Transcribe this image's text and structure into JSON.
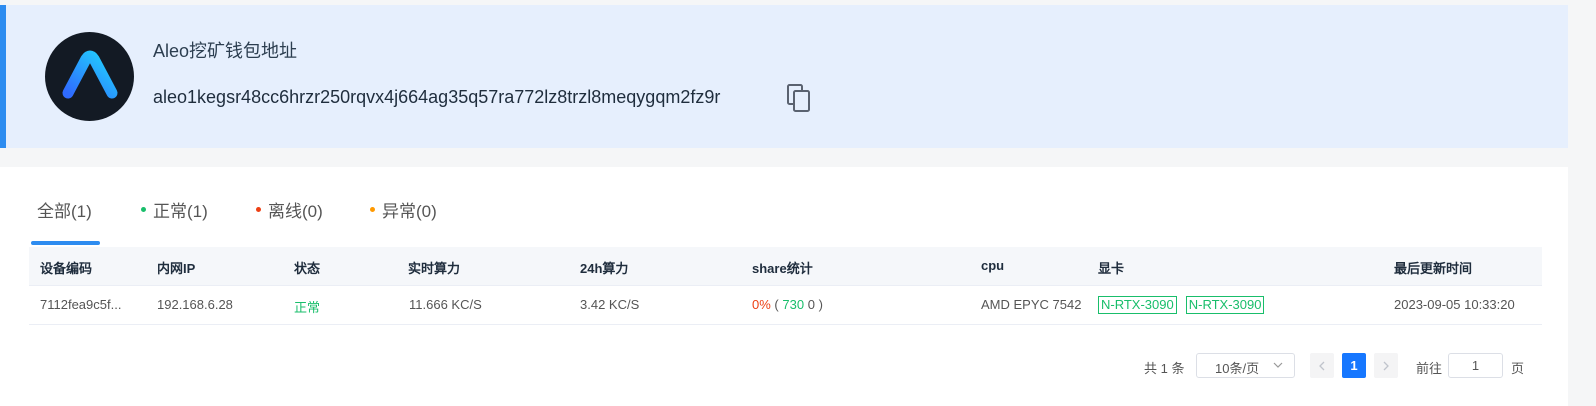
{
  "header": {
    "title": "Aleo挖矿钱包地址",
    "address": "aleo1kegsr48cc6hrzr250rqvx4j664ag35q57ra772lz8trzl8meqygqm2fz9r",
    "logo_icon": "aleo-logo-icon",
    "copy_icon": "copy-icon"
  },
  "tabs": [
    {
      "label": "全部(1)",
      "dot_color": null,
      "active": true
    },
    {
      "label": "正常(1)",
      "dot_color": "#19be6b",
      "active": false
    },
    {
      "label": "离线(0)",
      "dot_color": "#ed4014",
      "active": false
    },
    {
      "label": "异常(0)",
      "dot_color": "#ff9900",
      "active": false
    }
  ],
  "table": {
    "columns": [
      "设备编码",
      "内网IP",
      "状态",
      "实时算力",
      "24h算力",
      "share统计",
      "cpu",
      "显卡",
      "最后更新时间"
    ],
    "rows": [
      {
        "device_id": "7112fea9c5f...",
        "ip": "192.168.6.28",
        "status": "正常",
        "realtime_hashrate": "11.666 KC/S",
        "hashrate_24h": "3.42 KC/S",
        "share_pct": "0%",
        "share_open": "(",
        "share_valid": "730",
        "share_invalid": "0",
        "share_close": ")",
        "cpu": "AMD EPYC 7542",
        "gpus": [
          "N-RTX-3090",
          "N-RTX-3090"
        ],
        "updated": "2023-09-05 10:33:20"
      }
    ]
  },
  "pagination": {
    "total": "共 1 条",
    "page_size": "10条/页",
    "current_page": "1",
    "goto_label": "前往",
    "goto_value": "1",
    "goto_suffix": "页"
  },
  "colors": {
    "accent": "#2d8cf0",
    "success": "#19be6b",
    "danger": "#ed4014",
    "warning": "#ff9900"
  }
}
